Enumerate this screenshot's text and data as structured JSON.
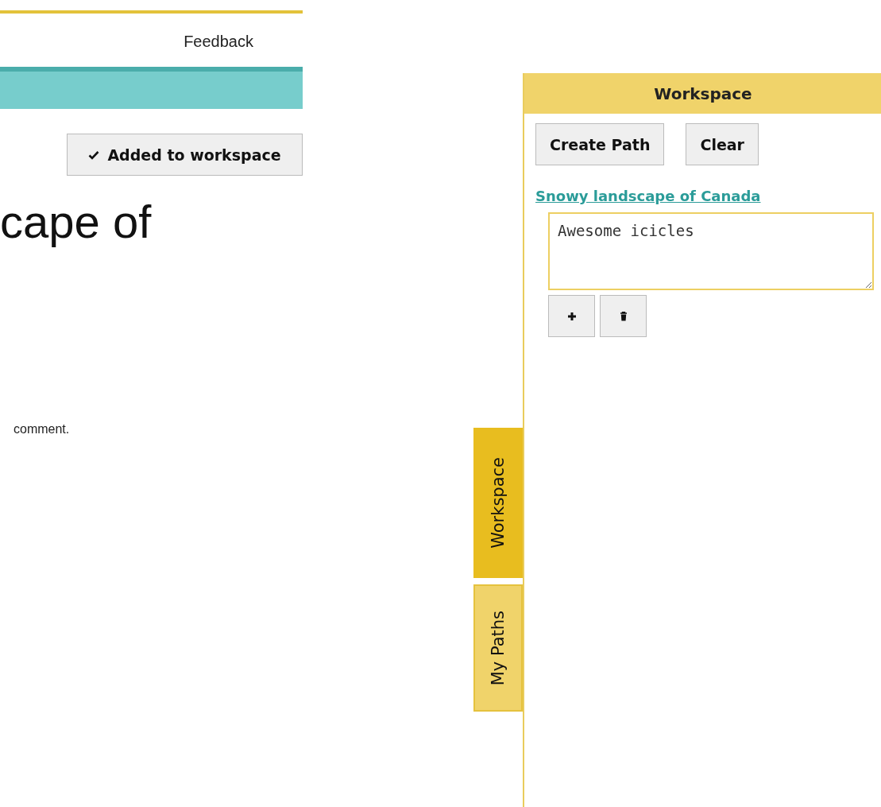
{
  "header": {
    "links": [
      "Feedback"
    ]
  },
  "add_button": {
    "label": "Added to workspace",
    "added": true
  },
  "heading": "cape of",
  "body_text": "comment.",
  "side_tabs": [
    {
      "label": "Workspace",
      "selected": true
    },
    {
      "label": "My Paths",
      "selected": false
    }
  ],
  "workspace": {
    "title": "Workspace",
    "buttons": [
      "Create Path",
      "Clear"
    ],
    "items": [
      {
        "title": "Snowy landscape of Canada",
        "note": "Awesome icicles"
      }
    ]
  }
}
